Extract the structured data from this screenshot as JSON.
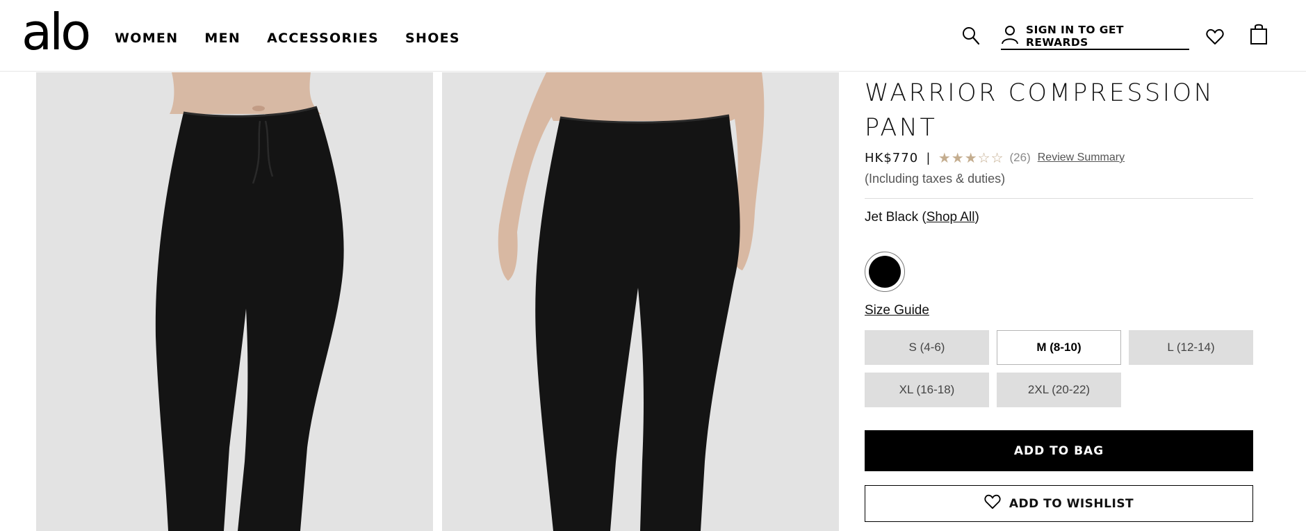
{
  "brand": {
    "logo_text": "alo"
  },
  "nav": {
    "items": [
      {
        "label": "WOMEN"
      },
      {
        "label": "MEN"
      },
      {
        "label": "ACCESSORIES"
      },
      {
        "label": "SHOES"
      }
    ]
  },
  "header": {
    "search_icon": "search-icon",
    "signin_label": "SIGN IN TO GET REWARDS",
    "user_icon": "user-icon",
    "wishlist_icon": "heart-icon",
    "bag_icon": "shopping-bag-icon"
  },
  "product": {
    "title_line1": "WARRIOR COMPRESSION",
    "title_line2": "PANT",
    "price": "HK$770",
    "separator": "|",
    "rating": {
      "stars_text": "★★★☆☆",
      "value": 3,
      "max": 5,
      "count_text": "(26)"
    },
    "review_summary_label": "Review Summary",
    "tax_note": "(Including taxes & duties)",
    "color_name": "Jet Black",
    "shop_all_open": " (",
    "shop_all_label": "Shop All",
    "shop_all_close": ")",
    "swatch_color": "#000000",
    "size_guide_label": "Size Guide",
    "sizes": [
      {
        "label": "S (4-6)"
      },
      {
        "label": "M (8-10)",
        "selected": true
      },
      {
        "label": "L (12-14)"
      },
      {
        "label": "XL (16-18)"
      },
      {
        "label": "2XL (20-22)"
      }
    ],
    "add_to_bag_label": "ADD TO BAG",
    "add_to_wishlist_label": "ADD TO WISHLIST"
  },
  "colors": {
    "accent": "#000000",
    "star": "#c4ad8f",
    "size_bg": "#dedede",
    "image_bg": "#e3e3e3"
  }
}
